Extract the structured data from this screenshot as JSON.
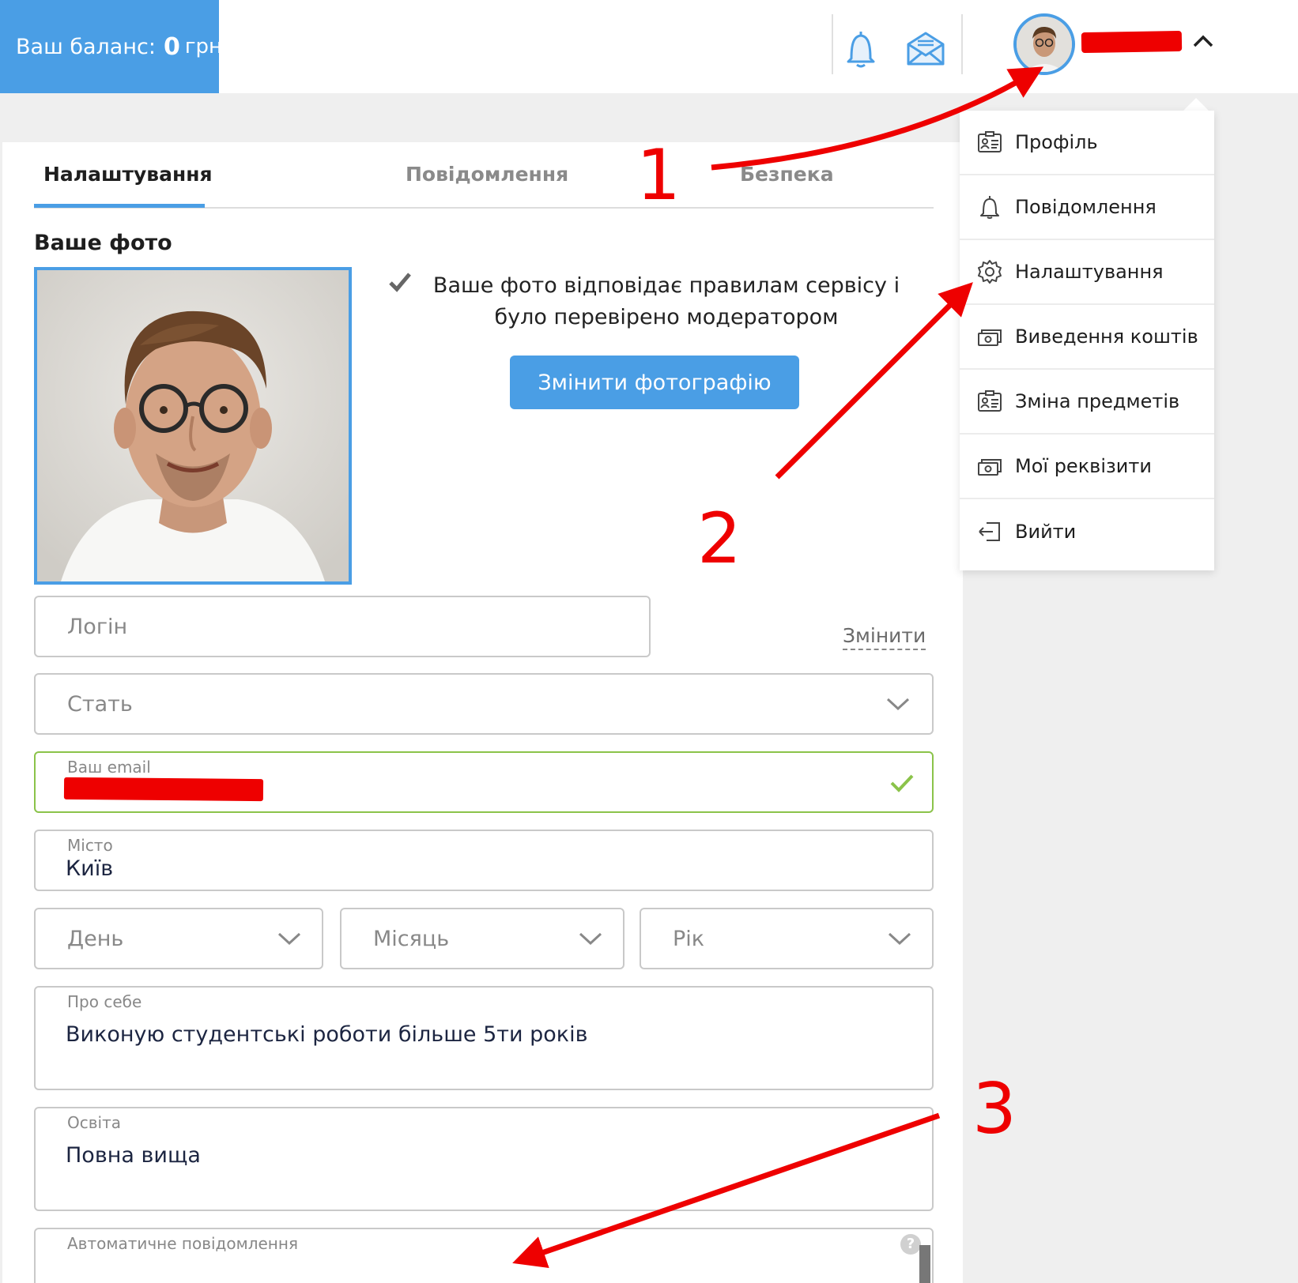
{
  "header": {
    "balance_label": "Ваш баланс:",
    "balance_amount": "0",
    "balance_currency": "грн",
    "icons": [
      "bell-icon",
      "mail-icon",
      "chevron-up-icon"
    ],
    "accent_color": "#4a9ee5"
  },
  "tabs": [
    {
      "label": "Налаштування",
      "active": true
    },
    {
      "label": "Повідомлення",
      "active": false
    },
    {
      "label": "Безпека",
      "active": false
    }
  ],
  "photo": {
    "title": "Ваше фото",
    "status_message": "Ваше фото відповідає правилам сервісу і було перевірено модератором",
    "change_button": "Змінити фотографію"
  },
  "form": {
    "login_placeholder": "Логін",
    "change_link": "Змінити",
    "gender_placeholder": "Стать",
    "email_label": "Ваш email",
    "city_label": "Місто",
    "city_value": "Київ",
    "day_placeholder": "День",
    "month_placeholder": "Місяць",
    "year_placeholder": "Рік",
    "about_label": "Про себе",
    "about_value": "Виконую студентські роботи більше 5ти років",
    "education_label": "Освіта",
    "education_value": "Повна вища",
    "auto_message_label": "Автоматичне повідомлення",
    "help_glyph": "?"
  },
  "menu": {
    "items": [
      {
        "label": "Профіль",
        "icon": "profile-card-icon"
      },
      {
        "label": "Повідомлення",
        "icon": "bell-icon"
      },
      {
        "label": "Налаштування",
        "icon": "gear-icon"
      },
      {
        "label": "Виведення коштів",
        "icon": "money-icon"
      },
      {
        "label": "Зміна предметів",
        "icon": "profile-card-icon"
      },
      {
        "label": "Мої реквізити",
        "icon": "money-icon"
      },
      {
        "label": "Вийти",
        "icon": "logout-icon"
      }
    ]
  },
  "annotations": {
    "step1": "1",
    "step2": "2",
    "step3": "3",
    "color": "#ee0000"
  }
}
